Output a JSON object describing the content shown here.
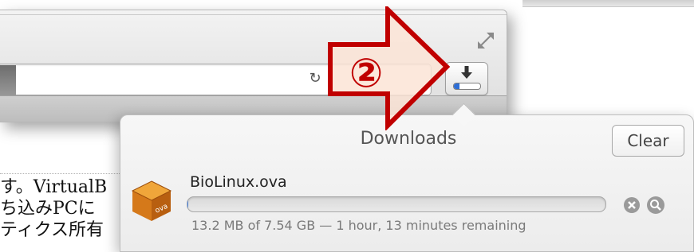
{
  "toolbar": {
    "fullscreen_icon": "fullscreen-icon",
    "reload_icon": "reload-icon",
    "reload_glyph": "↻",
    "download_icon": "download-arrow-icon",
    "download_progress": 0.2
  },
  "annotation": {
    "label": "②",
    "color": "#c00000"
  },
  "page": {
    "lines": [
      "す。VirtualB",
      "ち込みPCに",
      "ティクス所有"
    ]
  },
  "downloads": {
    "title": "Downloads",
    "clear_label": "Clear",
    "items": [
      {
        "name": "BioLinux.ova",
        "status": "13.2 MB of 7.54 GB — 1 hour, 13 minutes remaining",
        "progress": 0.002,
        "icon": "ova-package-icon",
        "cancel_icon": "cancel-icon",
        "reveal_icon": "magnifier-icon"
      }
    ]
  }
}
